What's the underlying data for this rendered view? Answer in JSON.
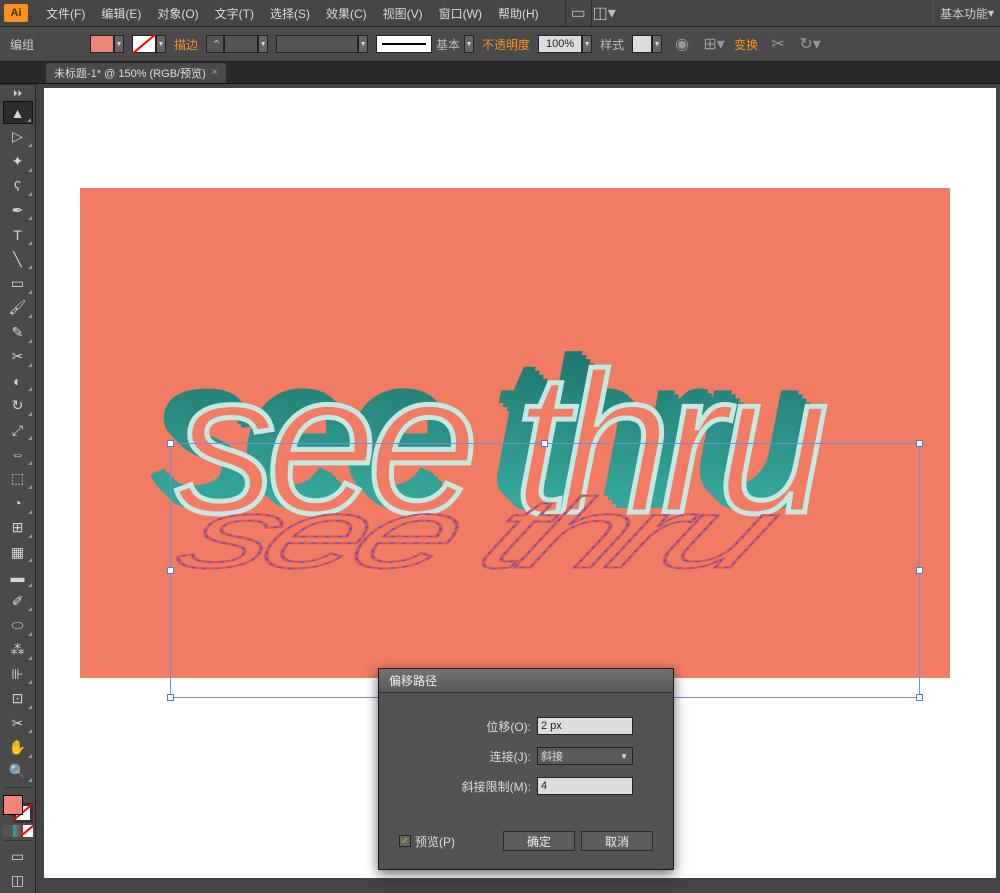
{
  "menubar": {
    "items": [
      "文件(F)",
      "编辑(E)",
      "对象(O)",
      "文字(T)",
      "选择(S)",
      "效果(C)",
      "视图(V)",
      "窗口(W)",
      "帮助(H)"
    ],
    "workspace": "基本功能"
  },
  "controlbar": {
    "context": "编组",
    "fill_color": "#ef8677",
    "stroke_label": "描边",
    "stroke_value": "",
    "profile_label": "基本",
    "opacity_label": "不透明度",
    "opacity_value": "100%",
    "style_label": "样式",
    "transform_label": "变换"
  },
  "tab": {
    "title": "未标题-1* @ 150% (RGB/预览)"
  },
  "tools": [
    "selection",
    "direct-selection",
    "magic-wand",
    "lasso",
    "pen",
    "type",
    "line",
    "rectangle",
    "paintbrush",
    "pencil",
    "blob-brush",
    "eraser",
    "rotate",
    "scale",
    "width",
    "free-transform",
    "shape-builder",
    "perspective-grid",
    "mesh",
    "gradient",
    "eyedropper",
    "blend",
    "symbol-sprayer",
    "column-graph",
    "artboard",
    "slice",
    "hand",
    "zoom"
  ],
  "canvas": {
    "artboard_bg": "#f17b63",
    "text_content": "see thru",
    "text_color": "#2a9d8f"
  },
  "dialog": {
    "title": "偏移路径",
    "offset_label": "位移(O):",
    "offset_value": "2 px",
    "join_label": "连接(J):",
    "join_value": "斜接",
    "miter_label": "斜接限制(M):",
    "miter_value": "4",
    "preview_label": "预览(P)",
    "ok": "确定",
    "cancel": "取消"
  }
}
